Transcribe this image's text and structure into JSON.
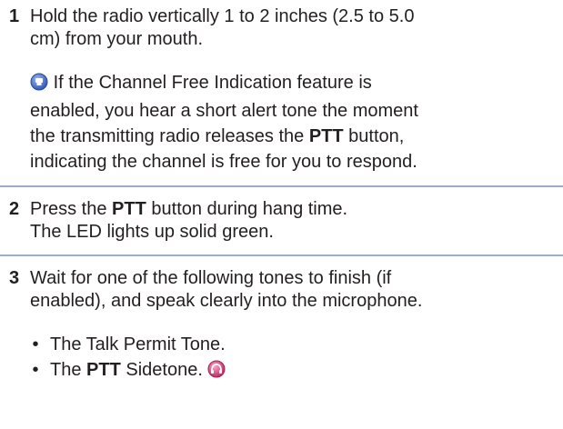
{
  "steps": [
    {
      "number": "1",
      "line1": "Hold the radio vertically 1 to 2 inches (2.5 to 5.0",
      "line2": "cm) from your mouth.",
      "note": {
        "icon": "feature-note-icon",
        "line1": "If the Channel Free Indication feature is",
        "line2": "enabled, you hear a short alert tone the moment",
        "line3_pre": "the transmitting radio releases the ",
        "line3_bold": "PTT",
        "line3_post": " button,",
        "line4": "indicating the channel is free for you to respond."
      }
    },
    {
      "number": "2",
      "line1_pre": "Press the ",
      "line1_bold": "PTT",
      "line1_post": " button during hang time.",
      "line2": "The LED lights up solid green."
    },
    {
      "number": "3",
      "line1": "Wait for one of the following tones to finish (if",
      "line2": "enabled), and speak clearly into the microphone.",
      "bullets": [
        {
          "marker": "•",
          "text": "The Talk Permit Tone."
        },
        {
          "marker": "•",
          "pre": "The ",
          "bold": "PTT",
          "post": " Sidetone.",
          "icon": "sidetone-icon"
        }
      ]
    }
  ],
  "colors": {
    "text": "#231f20",
    "divider": "#9aaec1",
    "note_icon": "#4a6fc4",
    "sidetone_icon": "#d9407a"
  }
}
